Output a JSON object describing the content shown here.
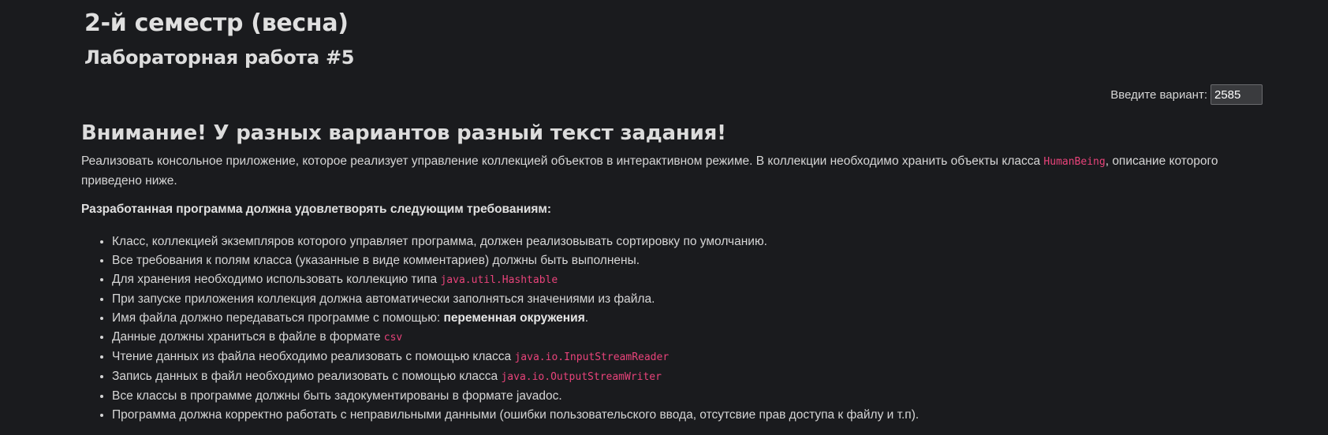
{
  "header": {
    "semester_title": "2-й семестр (весна)",
    "lab_title": "Лабораторная работа #5"
  },
  "variant": {
    "label": "Введите вариант:",
    "value": "2585"
  },
  "content": {
    "warning": "Внимание! У разных вариантов разный текст задания!",
    "intro_before": "Реализовать консольное приложение, которое реализует управление коллекцией объектов в интерактивном режиме. В коллекции необходимо хранить объекты класса ",
    "intro_code": "HumanBeing",
    "intro_after": ", описание которого приведено ниже.",
    "requirements_heading": "Разработанная программа должна удовлетворять следующим требованиям:",
    "requirements": [
      {
        "text": "Класс, коллекцией экземпляров которого управляет программа, должен реализовывать сортировку по умолчанию."
      },
      {
        "text": "Все требования к полям класса (указанные в виде комментариев) должны быть выполнены."
      },
      {
        "text": "Для хранения необходимо использовать коллекцию типа ",
        "code": "java.util.Hashtable"
      },
      {
        "text": "При запуске приложения коллекция должна автоматически заполняться значениями из файла."
      },
      {
        "text": "Имя файла должно передаваться программе с помощью: ",
        "bold": "переменная окружения",
        "after": "."
      },
      {
        "text": "Данные должны храниться в файле в формате ",
        "code": "csv"
      },
      {
        "text": "Чтение данных из файла необходимо реализовать с помощью класса ",
        "code": "java.io.InputStreamReader"
      },
      {
        "text": "Запись данных в файл необходимо реализовать с помощью класса ",
        "code": "java.io.OutputStreamWriter"
      },
      {
        "text": "Все классы в программе должны быть задокументированы в формате javadoc."
      },
      {
        "text": "Программа должна корректно работать с неправильными данными (ошибки пользовательского ввода, отсутсвие прав доступа к файлу и т.п)."
      }
    ]
  }
}
